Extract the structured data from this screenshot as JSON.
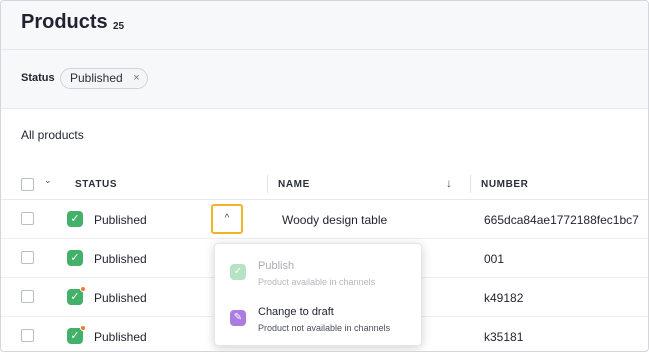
{
  "header": {
    "title": "Products",
    "count": "25"
  },
  "filters": {
    "label": "Status",
    "chip_label": "Published",
    "chip_close": "×"
  },
  "section": {
    "title": "All products"
  },
  "table": {
    "headers": {
      "status": "STATUS",
      "name": "NAME",
      "number": "NUMBER"
    },
    "select_all_chevron": "⌄",
    "sort_arrow": "↓",
    "rows": [
      {
        "status": "Published",
        "name": "Woody design table",
        "number": "665dca84ae1772188fec1bc7",
        "has_dot": false
      },
      {
        "status": "Published",
        "name": "",
        "number": "001",
        "has_dot": false
      },
      {
        "status": "Published",
        "name": "",
        "number": "k49182",
        "has_dot": true
      },
      {
        "status": "Published",
        "name": "",
        "number": "k35181",
        "has_dot": true
      }
    ]
  },
  "row_toggle": {
    "glyph": "^"
  },
  "status_menu": {
    "items": [
      {
        "title": "Publish",
        "subtitle": "Product available in channels",
        "icon": "check-icon",
        "glyph": "✓",
        "enabled": false
      },
      {
        "title": "Change to draft",
        "subtitle": "Product not available in channels",
        "icon": "pencil-icon",
        "glyph": "✎",
        "enabled": true
      }
    ]
  },
  "colors": {
    "published": "#43b16a",
    "dot": "#f07a2a",
    "focus": "#f0b429",
    "draft": "#a97ee0"
  }
}
